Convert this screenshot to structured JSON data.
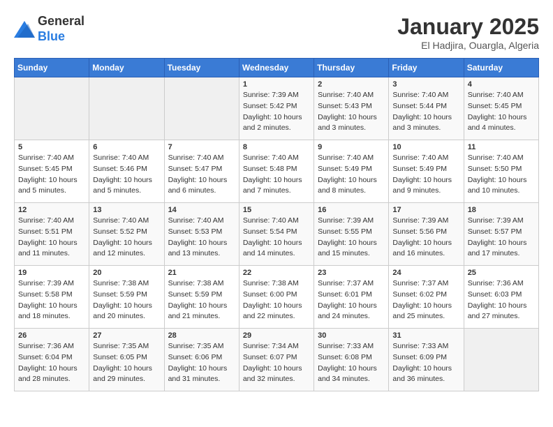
{
  "header": {
    "logo": {
      "general": "General",
      "blue": "Blue"
    },
    "title": "January 2025",
    "subtitle": "El Hadjira, Ouargla, Algeria"
  },
  "weekdays": [
    "Sunday",
    "Monday",
    "Tuesday",
    "Wednesday",
    "Thursday",
    "Friday",
    "Saturday"
  ],
  "weeks": [
    [
      {
        "num": "",
        "sunrise": "",
        "sunset": "",
        "daylight": ""
      },
      {
        "num": "",
        "sunrise": "",
        "sunset": "",
        "daylight": ""
      },
      {
        "num": "",
        "sunrise": "",
        "sunset": "",
        "daylight": ""
      },
      {
        "num": "1",
        "sunrise": "Sunrise: 7:39 AM",
        "sunset": "Sunset: 5:42 PM",
        "daylight": "Daylight: 10 hours and 2 minutes."
      },
      {
        "num": "2",
        "sunrise": "Sunrise: 7:40 AM",
        "sunset": "Sunset: 5:43 PM",
        "daylight": "Daylight: 10 hours and 3 minutes."
      },
      {
        "num": "3",
        "sunrise": "Sunrise: 7:40 AM",
        "sunset": "Sunset: 5:44 PM",
        "daylight": "Daylight: 10 hours and 3 minutes."
      },
      {
        "num": "4",
        "sunrise": "Sunrise: 7:40 AM",
        "sunset": "Sunset: 5:45 PM",
        "daylight": "Daylight: 10 hours and 4 minutes."
      }
    ],
    [
      {
        "num": "5",
        "sunrise": "Sunrise: 7:40 AM",
        "sunset": "Sunset: 5:45 PM",
        "daylight": "Daylight: 10 hours and 5 minutes."
      },
      {
        "num": "6",
        "sunrise": "Sunrise: 7:40 AM",
        "sunset": "Sunset: 5:46 PM",
        "daylight": "Daylight: 10 hours and 5 minutes."
      },
      {
        "num": "7",
        "sunrise": "Sunrise: 7:40 AM",
        "sunset": "Sunset: 5:47 PM",
        "daylight": "Daylight: 10 hours and 6 minutes."
      },
      {
        "num": "8",
        "sunrise": "Sunrise: 7:40 AM",
        "sunset": "Sunset: 5:48 PM",
        "daylight": "Daylight: 10 hours and 7 minutes."
      },
      {
        "num": "9",
        "sunrise": "Sunrise: 7:40 AM",
        "sunset": "Sunset: 5:49 PM",
        "daylight": "Daylight: 10 hours and 8 minutes."
      },
      {
        "num": "10",
        "sunrise": "Sunrise: 7:40 AM",
        "sunset": "Sunset: 5:49 PM",
        "daylight": "Daylight: 10 hours and 9 minutes."
      },
      {
        "num": "11",
        "sunrise": "Sunrise: 7:40 AM",
        "sunset": "Sunset: 5:50 PM",
        "daylight": "Daylight: 10 hours and 10 minutes."
      }
    ],
    [
      {
        "num": "12",
        "sunrise": "Sunrise: 7:40 AM",
        "sunset": "Sunset: 5:51 PM",
        "daylight": "Daylight: 10 hours and 11 minutes."
      },
      {
        "num": "13",
        "sunrise": "Sunrise: 7:40 AM",
        "sunset": "Sunset: 5:52 PM",
        "daylight": "Daylight: 10 hours and 12 minutes."
      },
      {
        "num": "14",
        "sunrise": "Sunrise: 7:40 AM",
        "sunset": "Sunset: 5:53 PM",
        "daylight": "Daylight: 10 hours and 13 minutes."
      },
      {
        "num": "15",
        "sunrise": "Sunrise: 7:40 AM",
        "sunset": "Sunset: 5:54 PM",
        "daylight": "Daylight: 10 hours and 14 minutes."
      },
      {
        "num": "16",
        "sunrise": "Sunrise: 7:39 AM",
        "sunset": "Sunset: 5:55 PM",
        "daylight": "Daylight: 10 hours and 15 minutes."
      },
      {
        "num": "17",
        "sunrise": "Sunrise: 7:39 AM",
        "sunset": "Sunset: 5:56 PM",
        "daylight": "Daylight: 10 hours and 16 minutes."
      },
      {
        "num": "18",
        "sunrise": "Sunrise: 7:39 AM",
        "sunset": "Sunset: 5:57 PM",
        "daylight": "Daylight: 10 hours and 17 minutes."
      }
    ],
    [
      {
        "num": "19",
        "sunrise": "Sunrise: 7:39 AM",
        "sunset": "Sunset: 5:58 PM",
        "daylight": "Daylight: 10 hours and 18 minutes."
      },
      {
        "num": "20",
        "sunrise": "Sunrise: 7:38 AM",
        "sunset": "Sunset: 5:59 PM",
        "daylight": "Daylight: 10 hours and 20 minutes."
      },
      {
        "num": "21",
        "sunrise": "Sunrise: 7:38 AM",
        "sunset": "Sunset: 5:59 PM",
        "daylight": "Daylight: 10 hours and 21 minutes."
      },
      {
        "num": "22",
        "sunrise": "Sunrise: 7:38 AM",
        "sunset": "Sunset: 6:00 PM",
        "daylight": "Daylight: 10 hours and 22 minutes."
      },
      {
        "num": "23",
        "sunrise": "Sunrise: 7:37 AM",
        "sunset": "Sunset: 6:01 PM",
        "daylight": "Daylight: 10 hours and 24 minutes."
      },
      {
        "num": "24",
        "sunrise": "Sunrise: 7:37 AM",
        "sunset": "Sunset: 6:02 PM",
        "daylight": "Daylight: 10 hours and 25 minutes."
      },
      {
        "num": "25",
        "sunrise": "Sunrise: 7:36 AM",
        "sunset": "Sunset: 6:03 PM",
        "daylight": "Daylight: 10 hours and 27 minutes."
      }
    ],
    [
      {
        "num": "26",
        "sunrise": "Sunrise: 7:36 AM",
        "sunset": "Sunset: 6:04 PM",
        "daylight": "Daylight: 10 hours and 28 minutes."
      },
      {
        "num": "27",
        "sunrise": "Sunrise: 7:35 AM",
        "sunset": "Sunset: 6:05 PM",
        "daylight": "Daylight: 10 hours and 29 minutes."
      },
      {
        "num": "28",
        "sunrise": "Sunrise: 7:35 AM",
        "sunset": "Sunset: 6:06 PM",
        "daylight": "Daylight: 10 hours and 31 minutes."
      },
      {
        "num": "29",
        "sunrise": "Sunrise: 7:34 AM",
        "sunset": "Sunset: 6:07 PM",
        "daylight": "Daylight: 10 hours and 32 minutes."
      },
      {
        "num": "30",
        "sunrise": "Sunrise: 7:33 AM",
        "sunset": "Sunset: 6:08 PM",
        "daylight": "Daylight: 10 hours and 34 minutes."
      },
      {
        "num": "31",
        "sunrise": "Sunrise: 7:33 AM",
        "sunset": "Sunset: 6:09 PM",
        "daylight": "Daylight: 10 hours and 36 minutes."
      },
      {
        "num": "",
        "sunrise": "",
        "sunset": "",
        "daylight": ""
      }
    ]
  ]
}
